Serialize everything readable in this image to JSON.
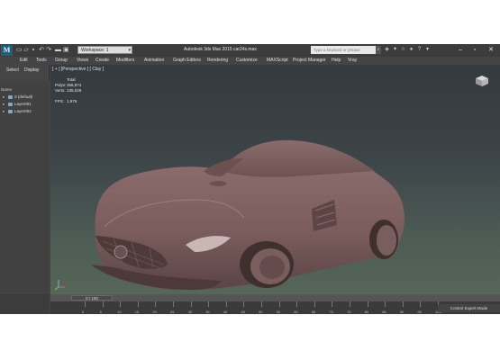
{
  "titlebar": {
    "workspace": "Workspace: 1",
    "title": "Autodesk 3ds Max 2015    car24s.max",
    "search_placeholder": "Type a keyword or phrase"
  },
  "menu": [
    "Edit",
    "Tools",
    "Group",
    "Views",
    "Create",
    "Modifiers",
    "Animation",
    "Graph Editors",
    "Rendering",
    "Customize",
    "MAXScript",
    "Project Manager",
    "Help",
    "Vray"
  ],
  "command_panel": {
    "tabs": [
      "Select",
      "Display"
    ],
    "name_header": "Name",
    "layers": [
      "0 (default)",
      "Layer001",
      "Layer002"
    ]
  },
  "viewport": {
    "label": "[ + ] [Perspective ] [ Clay ]",
    "stats": {
      "header": "Total",
      "polys_label": "Polys:",
      "polys": "366,974",
      "verts_label": "Verts:",
      "verts": "135,029",
      "fps_label": "FPS:",
      "fps": "1.976"
    }
  },
  "timeline": {
    "frame_counter": "0 / 100",
    "ticks": [
      "0",
      "5",
      "10",
      "15",
      "20",
      "25",
      "30",
      "35",
      "40",
      "45",
      "50",
      "55",
      "60",
      "65",
      "70",
      "75",
      "80",
      "85",
      "90",
      "95",
      "100"
    ],
    "status": "Control Expert Mode"
  },
  "colors": {
    "car_body": "#7d5f5f",
    "ui_dark": "#444444"
  }
}
